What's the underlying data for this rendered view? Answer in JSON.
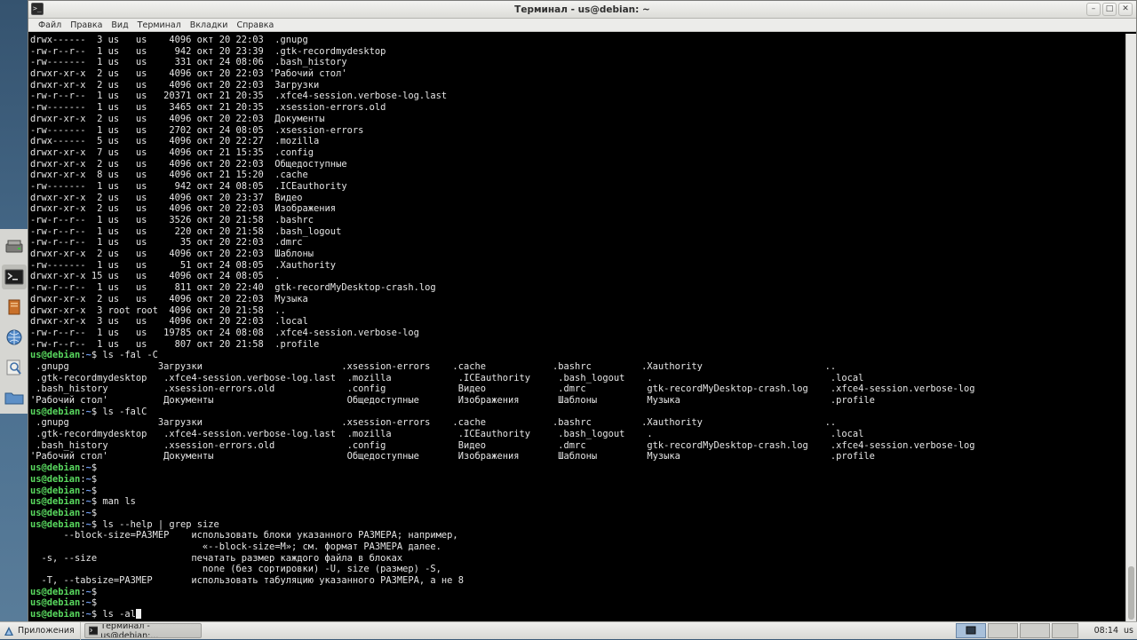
{
  "window": {
    "title": "Терминал - us@debian: ~",
    "icon": "terminal-icon",
    "controls": [
      "minimize",
      "maximize",
      "close"
    ]
  },
  "menubar": {
    "items": [
      "Файл",
      "Правка",
      "Вид",
      "Терминал",
      "Вкладки",
      "Справка"
    ]
  },
  "terminal": {
    "lines": [
      {
        "t": "drwx------  3 us   us    4096 окт 20 22:03  .gnupg"
      },
      {
        "t": "-rw-r--r--  1 us   us     942 окт 20 23:39  .gtk-recordmydesktop"
      },
      {
        "t": "-rw-------  1 us   us     331 окт 24 08:06  .bash_history"
      },
      {
        "t": "drwxr-xr-x  2 us   us    4096 окт 20 22:03 'Рабочий стол'"
      },
      {
        "t": "drwxr-xr-x  2 us   us    4096 окт 20 22:03  Загрузки"
      },
      {
        "t": "-rw-r--r--  1 us   us   20371 окт 21 20:35  .xfce4-session.verbose-log.last"
      },
      {
        "t": "-rw-------  1 us   us    3465 окт 21 20:35  .xsession-errors.old"
      },
      {
        "t": "drwxr-xr-x  2 us   us    4096 окт 20 22:03  Документы"
      },
      {
        "t": "-rw-------  1 us   us    2702 окт 24 08:05  .xsession-errors"
      },
      {
        "t": "drwx------  5 us   us    4096 окт 20 22:27  .mozilla"
      },
      {
        "t": "drwxr-xr-x  7 us   us    4096 окт 21 15:35  .config"
      },
      {
        "t": "drwxr-xr-x  2 us   us    4096 окт 20 22:03  Общедоступные"
      },
      {
        "t": "drwxr-xr-x  8 us   us    4096 окт 21 15:20  .cache"
      },
      {
        "t": "-rw-------  1 us   us     942 окт 24 08:05  .ICEauthority"
      },
      {
        "t": "drwxr-xr-x  2 us   us    4096 окт 20 23:37  Видео"
      },
      {
        "t": "drwxr-xr-x  2 us   us    4096 окт 20 22:03  Изображения"
      },
      {
        "t": "-rw-r--r--  1 us   us    3526 окт 20 21:58  .bashrc"
      },
      {
        "t": "-rw-r--r--  1 us   us     220 окт 20 21:58  .bash_logout"
      },
      {
        "t": "-rw-r--r--  1 us   us      35 окт 20 22:03  .dmrc"
      },
      {
        "t": "drwxr-xr-x  2 us   us    4096 окт 20 22:03  Шаблоны"
      },
      {
        "t": "-rw-------  1 us   us      51 окт 24 08:05  .Xauthority"
      },
      {
        "t": "drwxr-xr-x 15 us   us    4096 окт 24 08:05  ."
      },
      {
        "t": "-rw-r--r--  1 us   us     811 окт 20 22:40  gtk-recordMyDesktop-crash.log"
      },
      {
        "t": "drwxr-xr-x  2 us   us    4096 окт 20 22:03  Музыка"
      },
      {
        "t": "drwxr-xr-x  3 root root  4096 окт 20 21:58  .."
      },
      {
        "t": "drwxr-xr-x  3 us   us    4096 окт 20 22:03  .local"
      },
      {
        "t": "-rw-r--r--  1 us   us   19785 окт 24 08:08  .xfce4-session.verbose-log"
      },
      {
        "t": "-rw-r--r--  1 us   us     807 окт 20 21:58  .profile"
      },
      {
        "prompt": true,
        "user": "us@debian",
        "path": "~",
        "cmd": " ls -fal -C"
      },
      {
        "t": " .gnupg                Загрузки                         .xsession-errors    .cache            .bashrc         .Xauthority                      .."
      },
      {
        "t": " .gtk-recordmydesktop   .xfce4-session.verbose-log.last  .mozilla            .ICEauthority     .bash_logout    .                                .local"
      },
      {
        "t": " .bash_history          .xsession-errors.old             .config             Видео             .dmrc           gtk-recordMyDesktop-crash.log    .xfce4-session.verbose-log"
      },
      {
        "t": "'Рабочий стол'          Документы                        Общедоступные       Изображения       Шаблоны         Музыка                           .profile"
      },
      {
        "prompt": true,
        "user": "us@debian",
        "path": "~",
        "cmd": " ls -falC"
      },
      {
        "t": " .gnupg                Загрузки                         .xsession-errors    .cache            .bashrc         .Xauthority                      .."
      },
      {
        "t": " .gtk-recordmydesktop   .xfce4-session.verbose-log.last  .mozilla            .ICEauthority     .bash_logout    .                                .local"
      },
      {
        "t": " .bash_history          .xsession-errors.old             .config             Видео             .dmrc           gtk-recordMyDesktop-crash.log    .xfce4-session.verbose-log"
      },
      {
        "t": "'Рабочий стол'          Документы                        Общедоступные       Изображения       Шаблоны         Музыка                           .profile"
      },
      {
        "prompt": true,
        "user": "us@debian",
        "path": "~",
        "cmd": ""
      },
      {
        "prompt": true,
        "user": "us@debian",
        "path": "~",
        "cmd": ""
      },
      {
        "prompt": true,
        "user": "us@debian",
        "path": "~",
        "cmd": ""
      },
      {
        "prompt": true,
        "user": "us@debian",
        "path": "~",
        "cmd": " man ls"
      },
      {
        "prompt": true,
        "user": "us@debian",
        "path": "~",
        "cmd": ""
      },
      {
        "prompt": true,
        "user": "us@debian",
        "path": "~",
        "cmd": " ls --help | grep size"
      },
      {
        "t": "      --block-size=РАЗМЕР    использовать блоки указанного РАЗМЕРА; например,"
      },
      {
        "t": "                               «--block-size=M»; см. формат РАЗМЕРА далее."
      },
      {
        "t": "  -s, --size                 печатать размер каждого файла в блоках"
      },
      {
        "t": "                               none (без сортировки) -U, size (размер) -S,"
      },
      {
        "t": "  -T, --tabsize=РАЗМЕР       использовать табуляцию указанного РАЗМЕРА, а не 8"
      },
      {
        "prompt": true,
        "user": "us@debian",
        "path": "~",
        "cmd": ""
      },
      {
        "prompt": true,
        "user": "us@debian",
        "path": "~",
        "cmd": ""
      },
      {
        "prompt": true,
        "user": "us@debian",
        "path": "~",
        "cmd": " ls -al",
        "cursor": true
      }
    ]
  },
  "taskbar": {
    "apps_label": "Приложения",
    "task_label": "Терминал - us@debian:...",
    "clock": "08:14",
    "user": "us"
  },
  "colors": {
    "prompt_user": "#59d95f",
    "prompt_path": "#6f9df2",
    "terminal_bg": "#000000",
    "terminal_fg": "#e6e6e6"
  }
}
